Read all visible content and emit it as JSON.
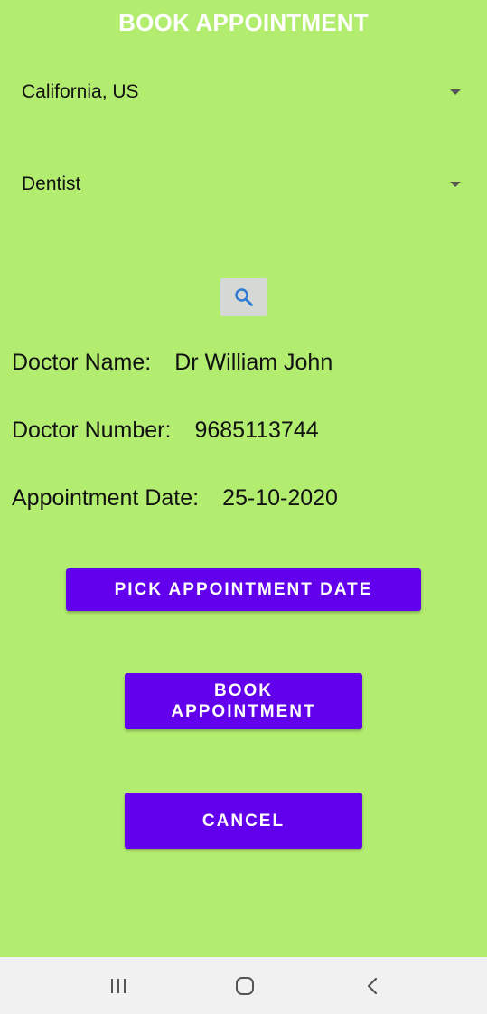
{
  "header": {
    "title": "BOOK APPOINTMENT"
  },
  "filters": {
    "location": "California, US",
    "specialty": "Dentist"
  },
  "search": {
    "icon": "search-icon"
  },
  "doctor": {
    "name_label": "Doctor Name:",
    "name_value": "Dr William John",
    "number_label": "Doctor Number:",
    "number_value": "9685113744",
    "date_label": "Appointment Date:",
    "date_value": "25-10-2020"
  },
  "buttons": {
    "pick_date": "PICK APPOINTMENT DATE",
    "book": "BOOK APPOINTMENT",
    "cancel": "CANCEL"
  },
  "nav": {
    "recents_icon": "recents-icon",
    "home_icon": "home-icon",
    "back_icon": "back-icon"
  },
  "colors": {
    "background": "#b3ed70",
    "accent": "#6200ee",
    "search_button_bg": "#d6d8d6",
    "search_icon": "#2d7ad1",
    "navbar_bg": "#f1f1f1"
  }
}
